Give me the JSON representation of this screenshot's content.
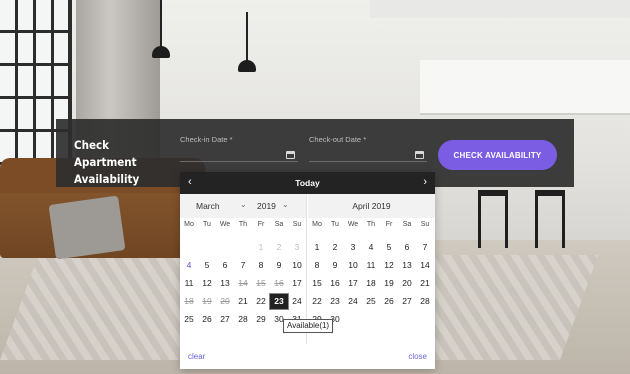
{
  "booking": {
    "title_line1": "Check Apartment",
    "title_line2": "Availability",
    "checkin_label": "Check-in Date *",
    "checkout_label": "Check-out Date *",
    "check_button": "CHECK AVAILABILITY"
  },
  "datepicker": {
    "header": "Today",
    "prev_icon": "‹",
    "next_icon": "›",
    "left_month_select": "March",
    "left_year_select": "2019",
    "right_month_title": "April 2019",
    "weekdays": [
      "Mo",
      "Tu",
      "We",
      "Th",
      "Fr",
      "Sa",
      "Su"
    ],
    "selected_day": "23",
    "tooltip": "Available(1)",
    "clear_label": "clear",
    "close_label": "close",
    "left_days": [
      [
        "",
        "",
        "",
        "",
        "1",
        "2",
        "3"
      ],
      [
        "4",
        "5",
        "6",
        "7",
        "8",
        "9",
        "10"
      ],
      [
        "11",
        "12",
        "13",
        "14",
        "15",
        "16",
        "17"
      ],
      [
        "18",
        "19",
        "20",
        "21",
        "22",
        "23",
        "24"
      ],
      [
        "25",
        "26",
        "27",
        "28",
        "29",
        "30",
        "31"
      ]
    ],
    "right_days": [
      [
        "1",
        "2",
        "3",
        "4",
        "5",
        "6",
        "7"
      ],
      [
        "8",
        "9",
        "10",
        "11",
        "12",
        "13",
        "14"
      ],
      [
        "15",
        "16",
        "17",
        "18",
        "19",
        "20",
        "21"
      ],
      [
        "22",
        "23",
        "24",
        "25",
        "26",
        "27",
        "28"
      ],
      [
        "29",
        "30",
        "",
        "",
        "",
        "",
        ""
      ]
    ]
  },
  "colors": {
    "accent": "#7b5de4",
    "bar_bg": "#2e2e2e",
    "selected_day": "#222222"
  },
  "icons": {
    "checkin": "calendar-icon",
    "checkout": "calendar-icon"
  }
}
